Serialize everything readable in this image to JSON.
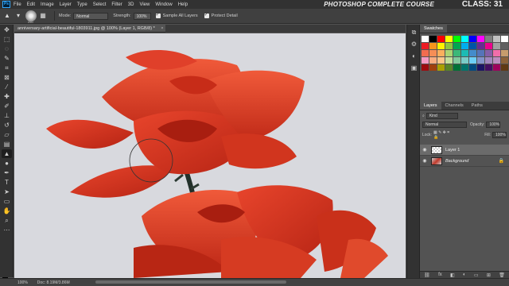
{
  "app": {
    "logo": "Ps"
  },
  "menu": [
    "File",
    "Edit",
    "Image",
    "Layer",
    "Type",
    "Select",
    "Filter",
    "3D",
    "View",
    "Window",
    "Help"
  ],
  "overlay": {
    "course_title": "PHOTOSHOP COMPLETE COURSE",
    "class_label": "CLASS: 31"
  },
  "options": {
    "brush_size": "250",
    "mode_label": "Mode:",
    "mode_value": "Normal",
    "strength_label": "Strength:",
    "strength_value": "100%",
    "sample_all_layers": "Sample All Layers",
    "protect_detail": "Protect Detail"
  },
  "document": {
    "tab_title": "anniversary-artificial-beautiful-1803911.jpg @ 100% (Layer 1, RGB/8) *",
    "close_glyph": "×"
  },
  "status": {
    "zoom": "100%",
    "doc": "Doc: 8.19M/3.86M"
  },
  "swatches": {
    "title": "Swatches",
    "colors": [
      "#ffffff",
      "#000000",
      "#ff0000",
      "#ffff00",
      "#00ff00",
      "#00ffff",
      "#0000ff",
      "#ff00ff",
      "#808080",
      "#c0c0c0",
      "#ffffff",
      "#ed1c24",
      "#f7941d",
      "#fff200",
      "#8dc63f",
      "#00a651",
      "#00aeef",
      "#0054a6",
      "#662d91",
      "#ec008c",
      "#a0a0a0",
      "#606060",
      "#f26c4f",
      "#f68e56",
      "#fbaf5d",
      "#acd372",
      "#3cb878",
      "#1cbbb4",
      "#448ccb",
      "#5674b9",
      "#855fa8",
      "#f06eaa",
      "#c69c6d",
      "#f49ac2",
      "#f9ad81",
      "#fdc68a",
      "#c4df9b",
      "#82ca9d",
      "#7accc8",
      "#6dcff6",
      "#8393ca",
      "#a186be",
      "#bd8cbf",
      "#8c6239",
      "#9e0b0f",
      "#a0410d",
      "#aba000",
      "#598527",
      "#007236",
      "#00746b",
      "#004a80",
      "#1b1464",
      "#440e62",
      "#9e005d",
      "#603913"
    ]
  },
  "layers_panel": {
    "tabs": [
      "Layers",
      "Channels",
      "Paths"
    ],
    "kind_label": "Kind",
    "blend_mode": "Normal",
    "opacity_label": "Opacity:",
    "opacity_value": "100%",
    "lock_label": "Lock:",
    "fill_label": "Fill:",
    "fill_value": "100%",
    "layers": [
      {
        "name": "Layer 1",
        "selected": true
      },
      {
        "name": "Background",
        "selected": false
      }
    ]
  }
}
